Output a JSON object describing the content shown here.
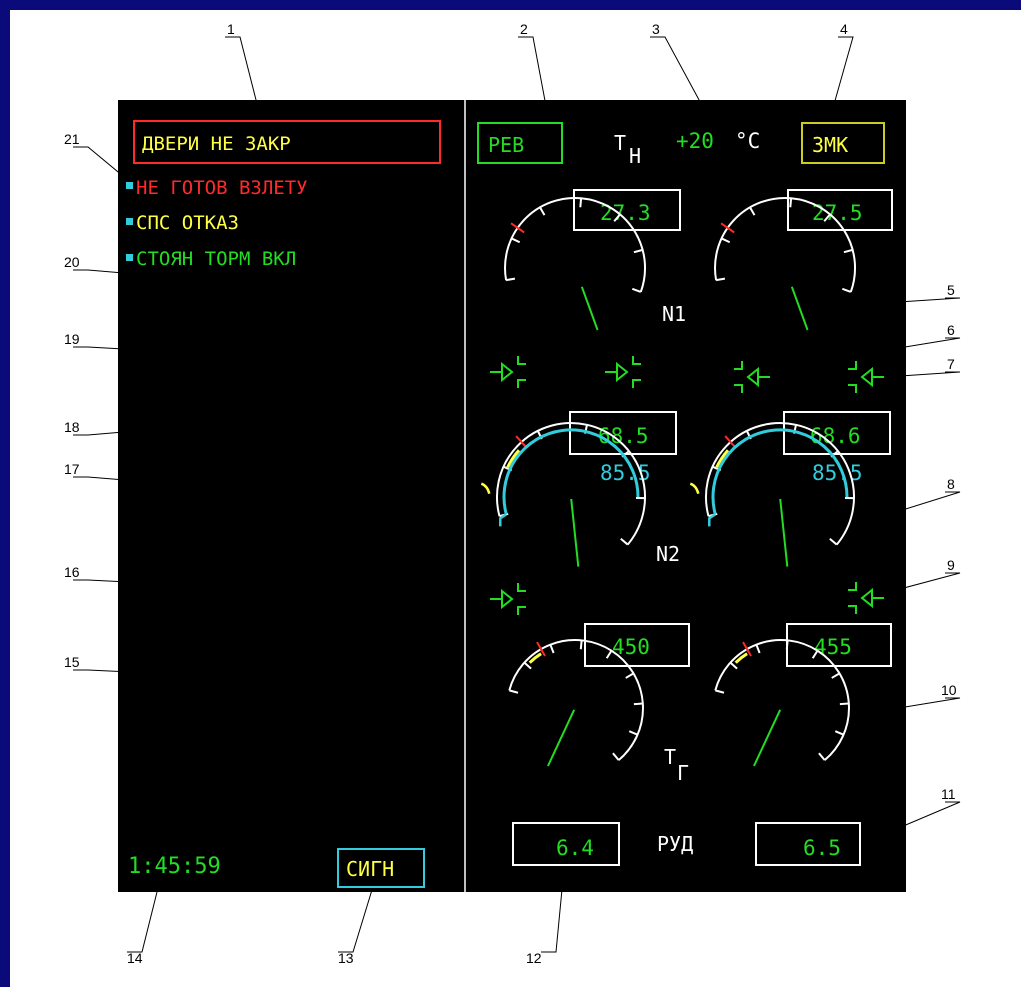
{
  "colors": {
    "frame": "#0a0a7a",
    "sheet": "#ffffff",
    "screen": "#000000",
    "green": "#22dd22",
    "white": "#ffffff",
    "yellow": "#ffff44",
    "red": "#ff2a2a",
    "cyan": "#33ccdd"
  },
  "callouts": [
    "1",
    "2",
    "3",
    "4",
    "5",
    "6",
    "7",
    "8",
    "9",
    "10",
    "11",
    "12",
    "13",
    "14",
    "15",
    "16",
    "17",
    "18",
    "19",
    "20",
    "21"
  ],
  "messages": {
    "door_warning": "ДВЕРИ НЕ ЗАКР",
    "not_ready": "НЕ ГОТОВ ВЗЛЕТУ",
    "sps_fail": "СПС ОТКАЗ",
    "parking_brake": "СТОЯН ТОРМ ВКЛ"
  },
  "status": {
    "reverse": "РЕВ",
    "outside_temp_label": "Т",
    "outside_temp_sub": "Н",
    "outside_temp_value": "+20",
    "outside_temp_unit": "°C",
    "lock": "ЗМК"
  },
  "gauges": {
    "n1": {
      "label": "N1",
      "left_value": "27.3",
      "right_value": "27.5"
    },
    "n2": {
      "label": "N2",
      "left_value": "68.5",
      "right_value": "68.6",
      "left_sub": "85.5",
      "right_sub": "85.5"
    },
    "tg": {
      "label_main": "Т",
      "label_sub": "Г",
      "left_value": "450",
      "right_value": "455"
    }
  },
  "throttle": {
    "label": "РУД",
    "left_value": "6.4",
    "right_value": "6.5"
  },
  "clock": "1:45:59",
  "signal_button": "СИГН"
}
